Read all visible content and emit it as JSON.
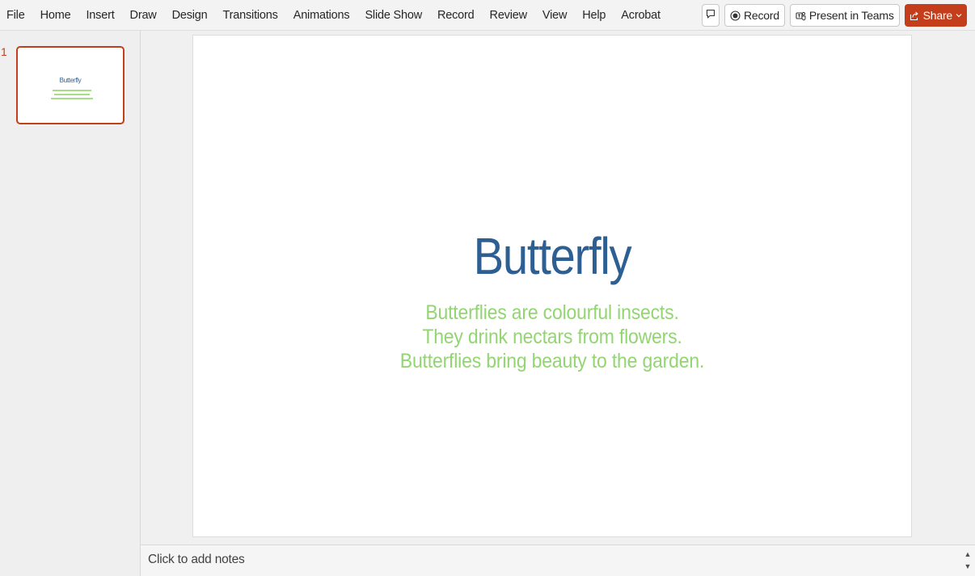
{
  "menu": {
    "tabs": [
      "File",
      "Home",
      "Insert",
      "Draw",
      "Design",
      "Transitions",
      "Animations",
      "Slide Show",
      "Record",
      "Review",
      "View",
      "Help",
      "Acrobat"
    ]
  },
  "toolbar": {
    "comment_icon": "comment-icon",
    "record_label": "Record",
    "record_icon": "record-icon",
    "present_label": "Present in Teams",
    "present_icon": "teams-icon",
    "share_label": "Share",
    "share_icon": "share-icon"
  },
  "thumbnails": [
    {
      "number": "1",
      "title": "Butterfly"
    }
  ],
  "slide": {
    "title": "Butterfly",
    "body_lines": [
      "Butterflies are colourful insects.",
      "They drink nectars from flowers.",
      "Butterflies bring beauty to the garden."
    ]
  },
  "notes": {
    "placeholder": "Click to add notes"
  },
  "colors": {
    "accent": "#c43e1c",
    "title": "#2e5f93",
    "body": "#93d572"
  }
}
